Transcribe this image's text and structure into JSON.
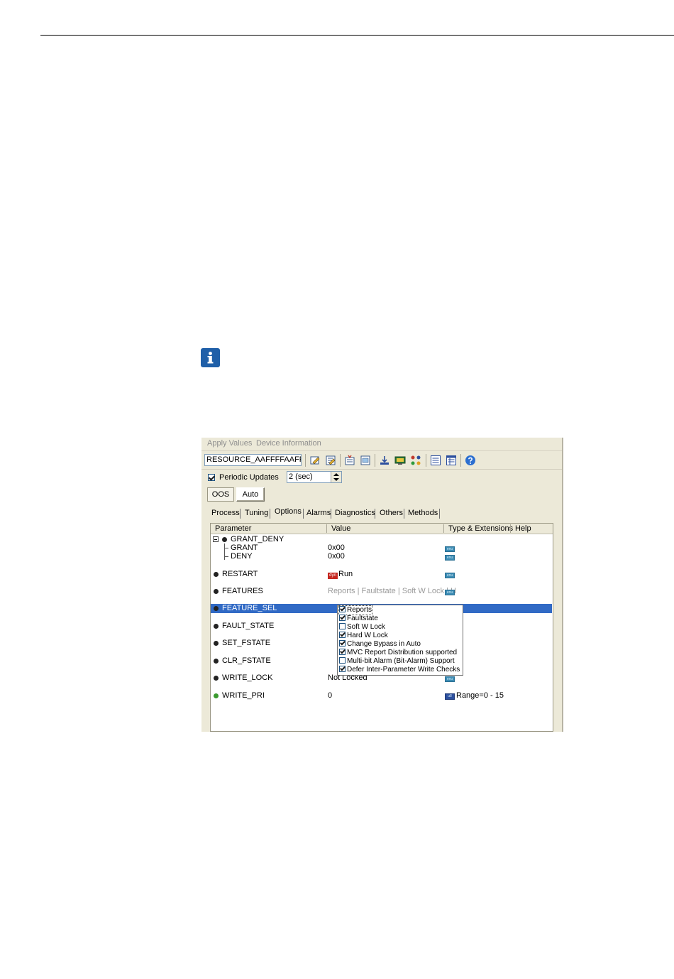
{
  "menu": {
    "items": [
      "Apply Values",
      "Device Information"
    ]
  },
  "toolbar": {
    "block_name": "RESOURCE_AAFFFFAAFFF ("
  },
  "periodic": {
    "label": "Periodic Updates",
    "checked": true,
    "interval": "2 (sec)"
  },
  "mode": {
    "oos_label": "OOS",
    "auto_label": "Auto"
  },
  "tabs": [
    "Process",
    "Tuning",
    "Options",
    "Alarms",
    "Diagnostics",
    "Others",
    "Methods"
  ],
  "active_tab": "Options",
  "grid": {
    "columns": [
      "Parameter",
      "Value",
      "Type & Extensions",
      "Help"
    ],
    "rows": [
      {
        "name": "GRANT_DENY",
        "value": "",
        "ext": "",
        "ext_text": ""
      },
      {
        "name": "GRANT",
        "value": "0x00",
        "ext": "enu",
        "ext_text": ""
      },
      {
        "name": "DENY",
        "value": "0x00",
        "ext": "enu",
        "ext_text": ""
      },
      {
        "name": "RESTART",
        "value": "Run",
        "value_tag": "dyn",
        "ext": "enu",
        "ext_text": ""
      },
      {
        "name": "FEATURES",
        "value": "Reports | Faultstate | Soft W Lock | H",
        "ext": "enu",
        "ext_text": ""
      },
      {
        "name": "FEATURE_SEL",
        "value": "",
        "ext": "",
        "ext_text": ""
      },
      {
        "name": "FAULT_STATE",
        "value": "",
        "ext": "",
        "ext_text": ""
      },
      {
        "name": "SET_FSTATE",
        "value": "",
        "ext": "",
        "ext_text": ""
      },
      {
        "name": "CLR_FSTATE",
        "value": "",
        "ext": "",
        "ext_text": ""
      },
      {
        "name": "WRITE_LOCK",
        "value": "Not Locked",
        "ext": "enu",
        "ext_text": ""
      },
      {
        "name": "WRITE_PRI",
        "value": "0",
        "ext": "u8",
        "ext_text": "Range=0 - 15"
      }
    ]
  },
  "feature_sel_options": [
    {
      "label": "Reports",
      "checked": true
    },
    {
      "label": "Faultstate",
      "checked": true
    },
    {
      "label": "Soft W Lock",
      "checked": false
    },
    {
      "label": "Hard W Lock",
      "checked": true
    },
    {
      "label": "Change Bypass in Auto",
      "checked": true
    },
    {
      "label": "MVC Report Distribution supported",
      "checked": true
    },
    {
      "label": "Multi-bit Alarm (Bit-Alarm) Support",
      "checked": false
    },
    {
      "label": "Defer Inter-Parameter Write Checks",
      "checked": true
    }
  ],
  "colors": {
    "selection": "#316ac5",
    "window": "#ece9d8",
    "info_icon": "#1f5fa8",
    "dyn_tag": "#c5271f"
  }
}
